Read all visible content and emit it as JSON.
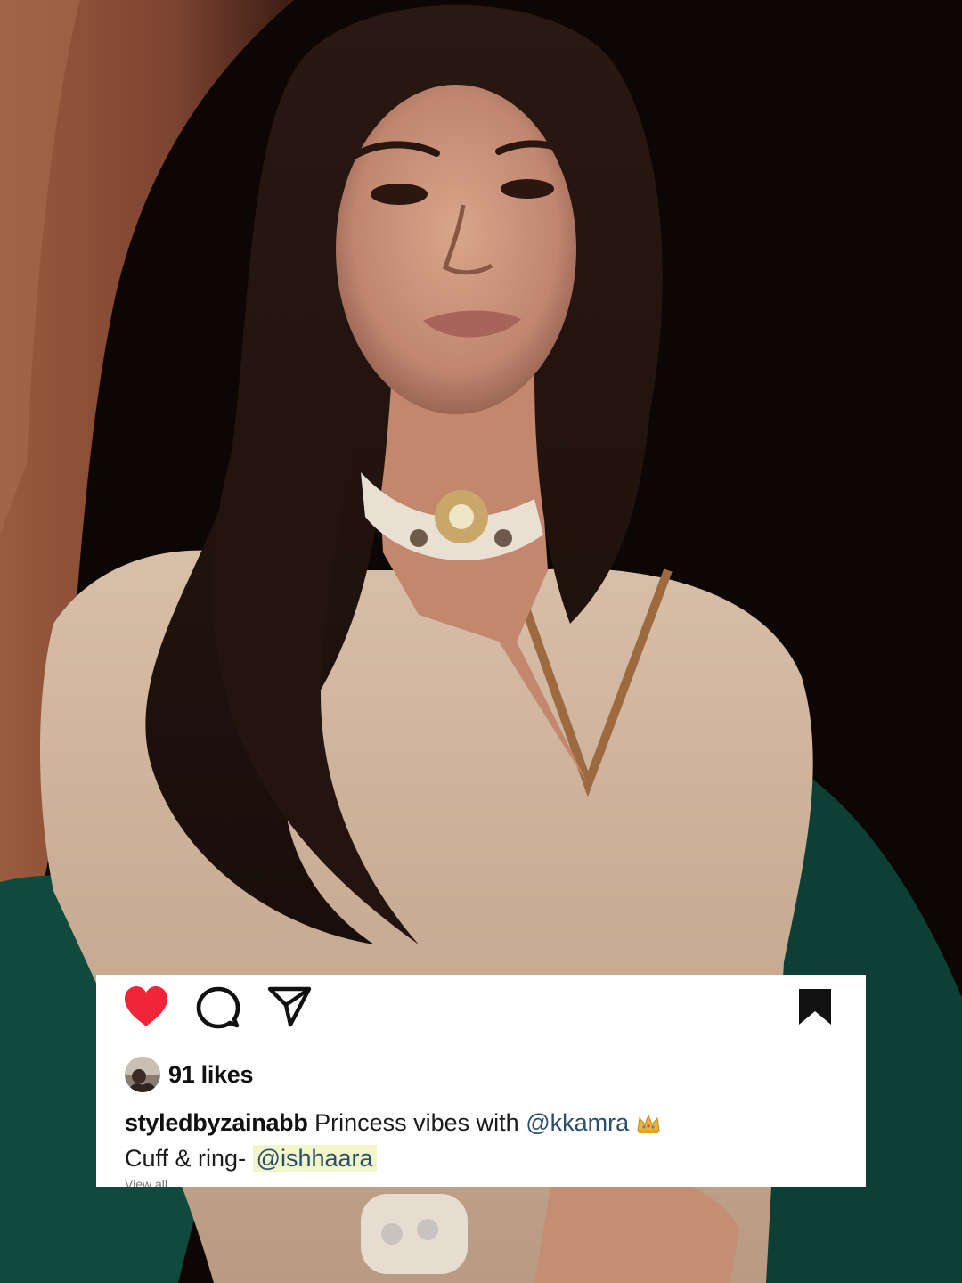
{
  "photo": {
    "description_icon": "portrait-photo"
  },
  "post": {
    "likes_text": "91 likes",
    "username": "styledbyzainabb",
    "caption_text_1": "Princess vibes with",
    "mention_1": "@kkamra",
    "caption_emoji": "crown-icon",
    "caption_text_2": "Cuff & ring-",
    "mention_2": "@ishhaara",
    "truncated_more": "View all ..."
  },
  "icons": {
    "like": "heart-icon",
    "comment": "comment-bubble-icon",
    "share": "paper-plane-icon",
    "save": "bookmark-icon"
  },
  "colors": {
    "like_red": "#f0253a",
    "mention_blue": "#2b4d70",
    "highlight": "#f2f7c9",
    "card_bg": "#ffffff"
  }
}
